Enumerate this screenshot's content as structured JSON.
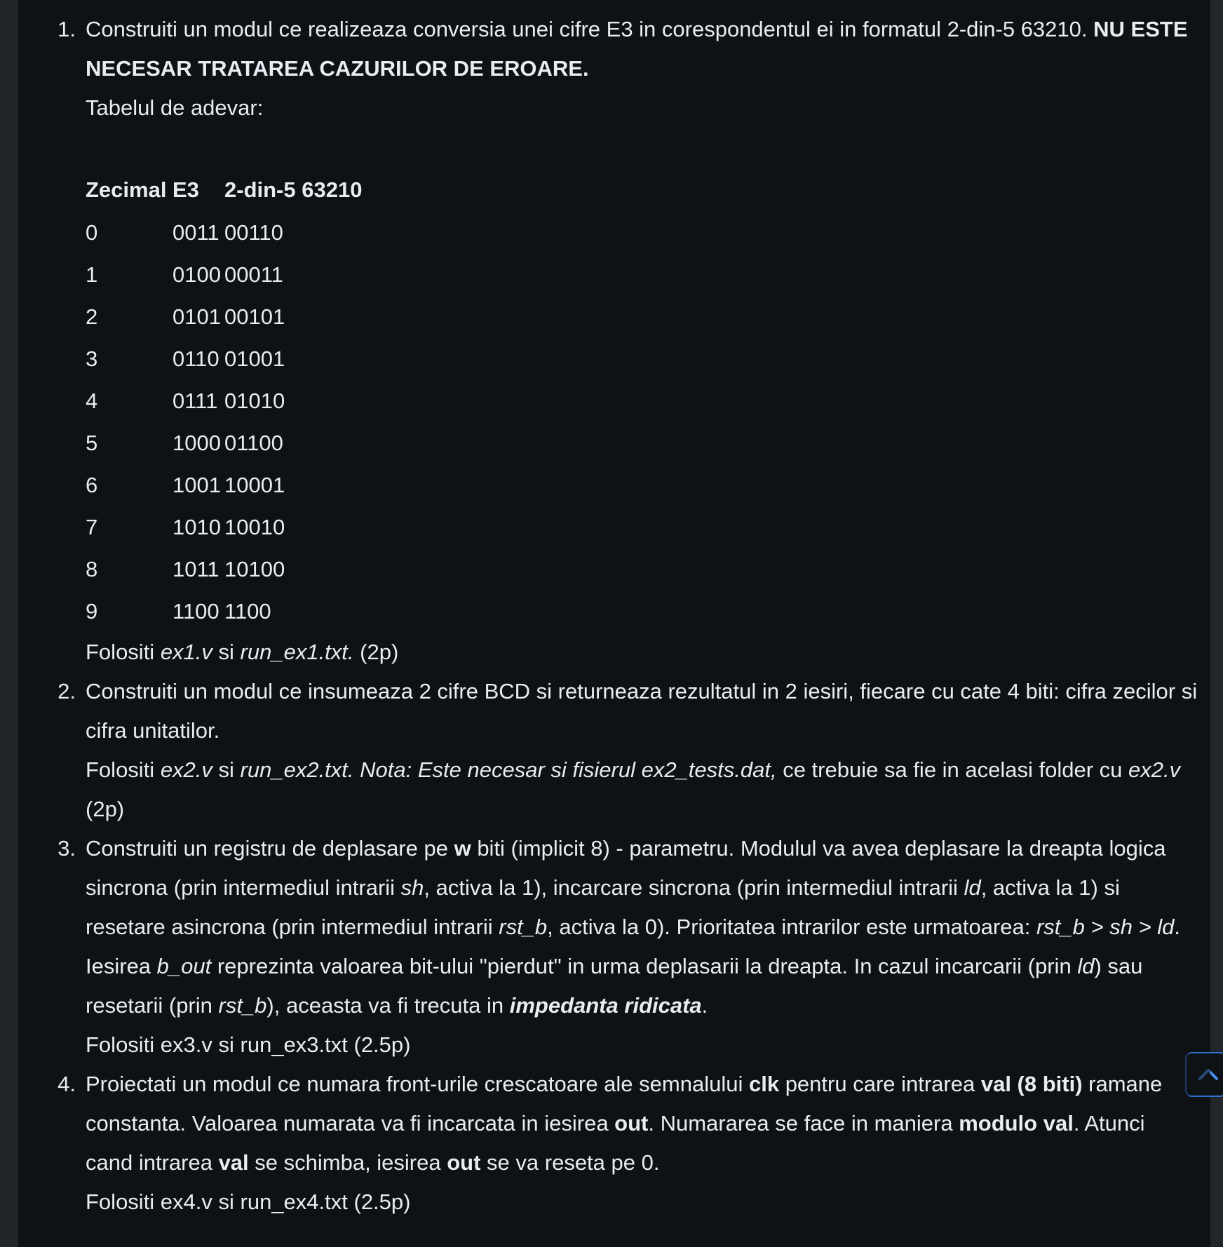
{
  "tasks": [
    {
      "number": "1.",
      "line1_a": "Construiti un modul ce realizeaza conversia unei cifre E3 in corespondentul ei in formatul 2-din-5 63210. ",
      "line1_bold": "NU ESTE NECESAR TRATAREA CAZURILOR DE EROARE.",
      "table_intro": "Tabelul de adevar:",
      "table": {
        "headers": [
          "Zecimal",
          "E3",
          "2-din-5 63210"
        ],
        "rows": [
          [
            "0",
            "0011",
            "00110"
          ],
          [
            "1",
            "0100",
            "00011"
          ],
          [
            "2",
            "0101",
            "00101"
          ],
          [
            "3",
            "0110",
            "01001"
          ],
          [
            "4",
            "0111",
            "01010"
          ],
          [
            "5",
            "1000",
            "01100"
          ],
          [
            "6",
            "1001",
            "10001"
          ],
          [
            "7",
            "1010",
            "10010"
          ],
          [
            "8",
            "1011",
            "10100"
          ],
          [
            "9",
            "1100",
            "1100"
          ]
        ]
      },
      "use_a": "Folositi ",
      "use_file1": "ex1.v",
      "use_b": " si ",
      "use_file2": "run_ex1.txt.",
      "use_c": " (2p)"
    },
    {
      "number": "2.",
      "text": "Construiti un modul ce insumeaza 2 cifre BCD si returneaza rezultatul in 2 iesiri, fiecare cu cate 4 biti: cifra zecilor si cifra unitatilor.",
      "use_a": "Folositi ",
      "use_file1": "ex2.v",
      "use_b": " si ",
      "use_italic": "run_ex2.txt. Nota: Este necesar si fisierul ex2_tests.dat,",
      "use_c": " ce trebuie sa fie in acelasi folder cu ",
      "use_file3": "ex2.v",
      "use_d": " (2p)"
    },
    {
      "number": "3.",
      "t1": "Construiti un registru de deplasare pe ",
      "w": "w",
      "t2": " biti (implicit 8) - parametru. Modulul va avea deplasare la dreapta logica sincrona (prin intermediul intrarii ",
      "sh": "sh",
      "t3": ", activa la 1), incarcare sincrona (prin intermediul intrarii ",
      "ld": "ld",
      "t4": ", activa la 1) si resetare asincrona (prin intermediul intrarii ",
      "rst_b": "rst_b",
      "t5": ", activa la 0). Prioritatea intrarilor este urmatoarea: ",
      "priority": "rst_b > sh > ld",
      "t6": ". Iesirea ",
      "b_out": "b_out",
      "t7": " reprezinta valoarea bit-ului \"pierdut\" in urma deplasarii la dreapta. In cazul incarcarii (prin ",
      "ld2": "ld",
      "t8": ") sau resetarii (prin ",
      "rst_b2": "rst_b",
      "t9": "), aceasta va fi trecuta in ",
      "impedance": "impedanta ridicata",
      "t10": ".",
      "use": "Folositi ex3.v si run_ex3.txt (2.5p)"
    },
    {
      "number": "4.",
      "t1": "Proiectati un modul ce numara front-urile crescatoare ale semnalului ",
      "clk": "clk",
      "t2": " pentru care intrarea ",
      "val8": "val (8 biti)",
      "t3": " ramane constanta. Valoarea numarata va fi incarcata in iesirea ",
      "out": "out",
      "t4": ". Numararea se face in maniera ",
      "modulo": "modulo val",
      "t5": ". Atunci cand intrarea ",
      "val": "val",
      "t6": " se schimba, iesirea ",
      "out2": "out",
      "t7": " se va reseta pe 0.",
      "use": "Folositi ex4.v si run_ex4.txt (2.5p)"
    }
  ],
  "icons": {
    "back_to_top": "chevron-up-icon"
  },
  "colors": {
    "background": "#0f1215",
    "text": "#e6edf3",
    "accent": "#2f6fd0"
  }
}
